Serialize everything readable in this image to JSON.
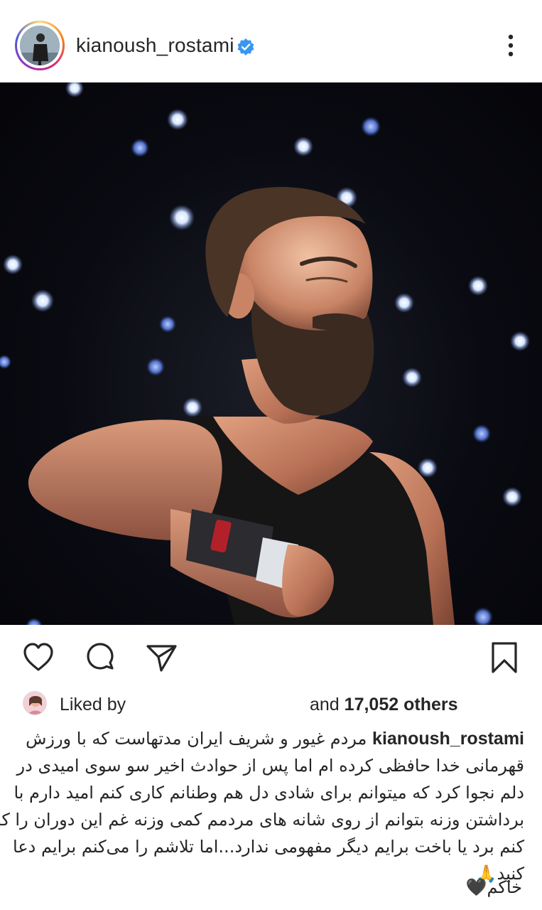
{
  "post": {
    "username": "kianoush_rostami",
    "verified": true,
    "menu_icon": "more-vertical-icon"
  },
  "actions": {
    "like_icon": "heart-icon",
    "comment_icon": "comment-icon",
    "share_icon": "send-icon",
    "save_icon": "bookmark-icon"
  },
  "likes": {
    "liked_by_label": "Liked by",
    "and_label": "and",
    "count": "17,052",
    "others_label": "others"
  },
  "caption": {
    "lines": [
      "مردم غیور و شریف ایران  مدتهاست  که با ورزش",
      "قهرمانی خدا حافظی کرده ام  اما پس از حوادث اخیر سو سوی امیدی در",
      "دلم نجوا کرد که میتوانم برای شادی دل هم وطنانم کاری کنم امید دارم با",
      "برداشتن وزنه بتوانم از روی شانه های مردمم کمی  وزنه غم این دوران را کم",
      "کنم برد یا باخت برایم دیگر مفهومی ندارد...اما تلاشم را می‌کنم برایم دعا",
      "کنید🙏"
    ],
    "sign_off": "خاکم🖤"
  },
  "colors": {
    "text": "#262626",
    "verified_blue": "#3897f0",
    "background": "#ffffff"
  }
}
